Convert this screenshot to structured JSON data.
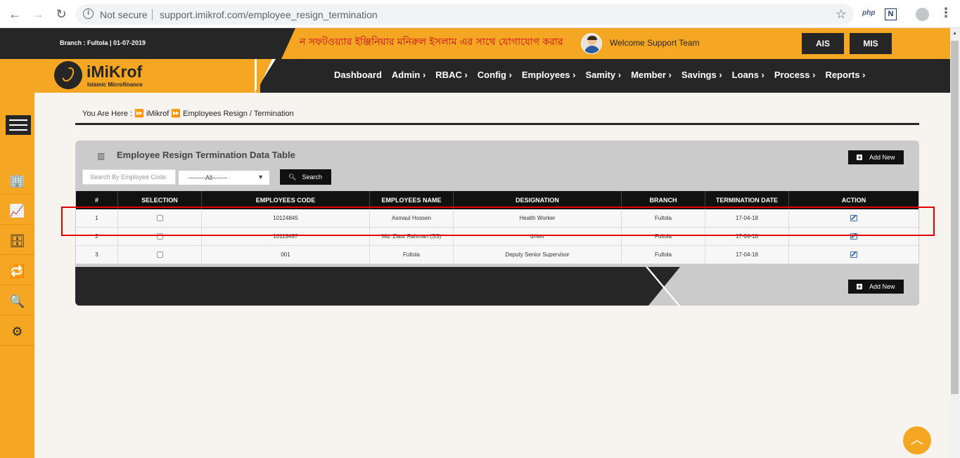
{
  "browser": {
    "security_label": "Not secure",
    "url": "support.imikrof.com/employee_resign_termination",
    "ext_php": "php",
    "ext_n": "N"
  },
  "header": {
    "branch_info": "Branch : Fultola |  01-07-2019",
    "marquee": "ন সফটওয়্যার ইঞ্জিনিয়ার মনিরুল ইসলাম এর সাথে যোগাযোগ করার হ",
    "welcome": "Welcome Support Team",
    "ais_label": "AIS",
    "mis_label": "MIS"
  },
  "logo": {
    "name": "iMiKrof",
    "tagline": "Islamic Microfinance"
  },
  "menu": [
    {
      "label": "Dashboard"
    },
    {
      "label": "Admin ›"
    },
    {
      "label": "RBAC ›"
    },
    {
      "label": "Config ›"
    },
    {
      "label": "Employees ›"
    },
    {
      "label": "Samity ›"
    },
    {
      "label": "Member ›"
    },
    {
      "label": "Savings ›"
    },
    {
      "label": "Loans ›"
    },
    {
      "label": "Process ›"
    },
    {
      "label": "Reports ›"
    }
  ],
  "breadcrumb": {
    "prefix": "You Are Here  :  ⏩  iMikrof  ⏩   Employees Resign / Termination"
  },
  "panel": {
    "title": "Employee Resign Termination Data Table",
    "add_new": "Add New",
    "search_placeholder": "Search By Employee Code",
    "select_value": "--------All-------",
    "search_label": "Search"
  },
  "table": {
    "headers": [
      "#",
      "SELECTION",
      "EMPLOYEES CODE",
      "EMPLOYEES NAME",
      "DESIGNATION",
      "BRANCH",
      "TERMINATION DATE",
      "ACTION"
    ],
    "rows": [
      {
        "no": "1",
        "code": "10124845",
        "name": "Asmaul Hossen",
        "designation": "Health Worker",
        "branch": "Fultola",
        "date": "17-04-18"
      },
      {
        "no": "2",
        "code": "10119497",
        "name": "Md. Ziaur Rahman (SS)",
        "designation": "driver",
        "branch": "Fultola",
        "date": "17-04-18"
      },
      {
        "no": "3",
        "code": "001",
        "name": "Fultola",
        "designation": "Deputy Senior Supervisor",
        "branch": "Fultola",
        "date": "17-04-18"
      }
    ]
  },
  "colors": {
    "accent": "#f5a623",
    "dark": "#262626",
    "highlight": "#e00000"
  }
}
